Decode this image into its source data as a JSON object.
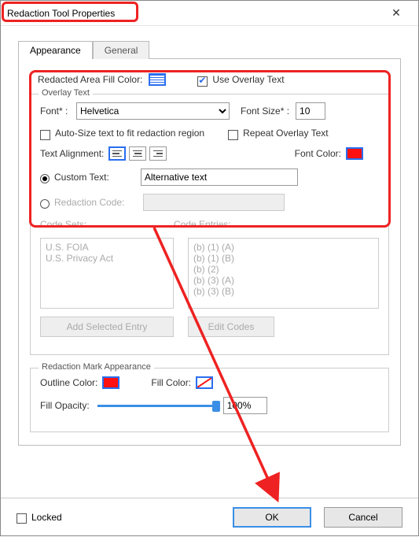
{
  "window": {
    "title": "Redaction Tool Properties"
  },
  "tabs": {
    "appearance": "Appearance",
    "general": "General"
  },
  "fill_color_label": "Redacted Area Fill Color:",
  "use_overlay_label": "Use Overlay Text",
  "overlay": {
    "group_title": "Overlay Text",
    "font_label": "Font* :",
    "font_value": "Helvetica",
    "font_size_label": "Font Size* :",
    "font_size_value": "10",
    "autosize_label": "Auto-Size text to fit redaction region",
    "repeat_label": "Repeat Overlay Text",
    "align_label": "Text Alignment:",
    "font_color_label": "Font Color:",
    "custom_text_label": "Custom Text:",
    "custom_text_value": "Alternative text",
    "redaction_code_label": "Redaction Code:",
    "code_sets_label": "Code Sets:",
    "code_entries_label": "Code Entries:",
    "code_sets": [
      "U.S. FOIA",
      "U.S. Privacy Act"
    ],
    "code_entries": [
      "(b) (1) (A)",
      "(b) (1) (B)",
      "(b) (2)",
      "(b) (3) (A)",
      "(b) (3) (B)"
    ],
    "add_entry_btn": "Add Selected Entry",
    "edit_codes_btn": "Edit Codes"
  },
  "mark": {
    "group_title": "Redaction Mark Appearance",
    "outline_label": "Outline Color:",
    "fill_label": "Fill Color:",
    "opacity_label": "Fill Opacity:",
    "opacity_value": "100%"
  },
  "footer": {
    "locked": "Locked",
    "ok": "OK",
    "cancel": "Cancel"
  }
}
